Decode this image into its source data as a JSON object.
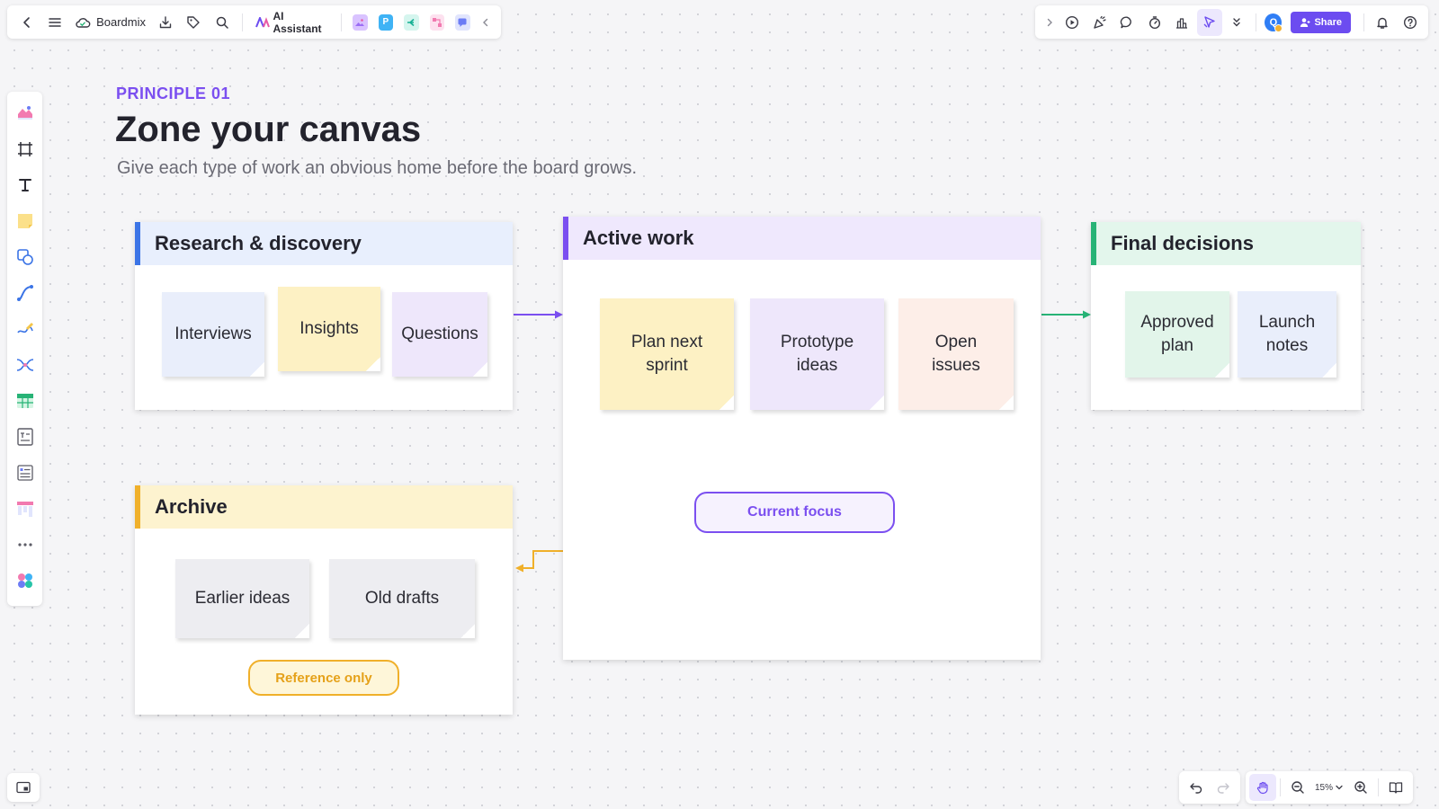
{
  "app": {
    "name": "Boardmix",
    "ai_assistant_label": "AI Assistant",
    "mini_apps": [
      {
        "glyph": "",
        "color": "#c9a6ff"
      },
      {
        "glyph": "P",
        "color": "#3fb3f5"
      },
      {
        "glyph": "",
        "color": "#27c4a8"
      },
      {
        "glyph": "",
        "color": "#f27ab0"
      },
      {
        "glyph": "",
        "color": "#6c7cf5"
      }
    ]
  },
  "header_right": {
    "avatar_initial": "Q",
    "share_label": "Share"
  },
  "zoom": {
    "level": "15%"
  },
  "canvas": {
    "eyebrow": "PRINCIPLE 01",
    "title": "Zone your canvas",
    "subtitle": "Give each type of work an obvious home before the board grows."
  },
  "zones": {
    "research": {
      "title": "Research & discovery",
      "accent": "#3b74e6",
      "header_bg": "#e8effd",
      "notes": [
        "Interviews",
        "Insights",
        "Questions"
      ]
    },
    "active": {
      "title": "Active work",
      "accent": "#7b4ff0",
      "header_bg": "#efe8fd",
      "notes": [
        "Plan next sprint",
        "Prototype ideas",
        "Open issues"
      ],
      "pill": "Current focus"
    },
    "final": {
      "title": "Final decisions",
      "accent": "#27b376",
      "header_bg": "#e3f6ec",
      "notes": [
        "Approved plan",
        "Launch notes"
      ]
    },
    "archive": {
      "title": "Archive",
      "accent": "#f0b02a",
      "header_bg": "#fdf3cf",
      "notes": [
        "Earlier ideas",
        "Old drafts"
      ],
      "pill": "Reference only"
    }
  },
  "colors": {
    "sticky_blue": "#e9eefb",
    "sticky_yellow": "#fdf1c4",
    "sticky_purple": "#eee7fb",
    "sticky_peach": "#fdeee8",
    "sticky_green": "#e2f5ea",
    "sticky_gray": "#ededf1",
    "brand_purple": "#6c4cf0"
  }
}
